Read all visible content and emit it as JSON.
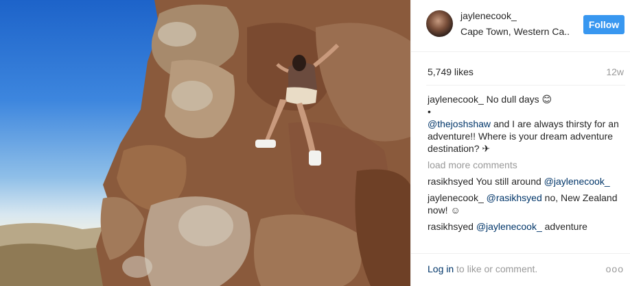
{
  "post": {
    "username": "jaylenecook_",
    "location": "Cape Town, Western Ca...",
    "follow_label": "Follow",
    "likes": "5,749 likes",
    "age": "12w",
    "caption_user": "jaylenecook_",
    "caption_line1": "No dull days 😊",
    "caption_bullet": "•",
    "caption_mention": "@thejoshshaw",
    "caption_rest": "and I are always thirsty for an adventure!! Where is your dream adventure destination? ✈",
    "load_more": "load more comments",
    "comments": [
      {
        "user": "rasikhsyed",
        "text_before": "You still around",
        "mention": "@jaylenecook_",
        "text_after": ""
      },
      {
        "user": "jaylenecook_",
        "text_before": "",
        "mention": "@rasikhsyed",
        "text_after": "no, New Zealand now! ☺"
      },
      {
        "user": "rasikhsyed",
        "text_before": "",
        "mention": "@jaylenecook_",
        "text_after": "adventure"
      }
    ],
    "login_link": "Log in",
    "login_rest": "to like or comment.",
    "more_icon": "ooo"
  },
  "colors": {
    "accent": "#3897f0",
    "link": "#003569",
    "muted": "#999999"
  }
}
